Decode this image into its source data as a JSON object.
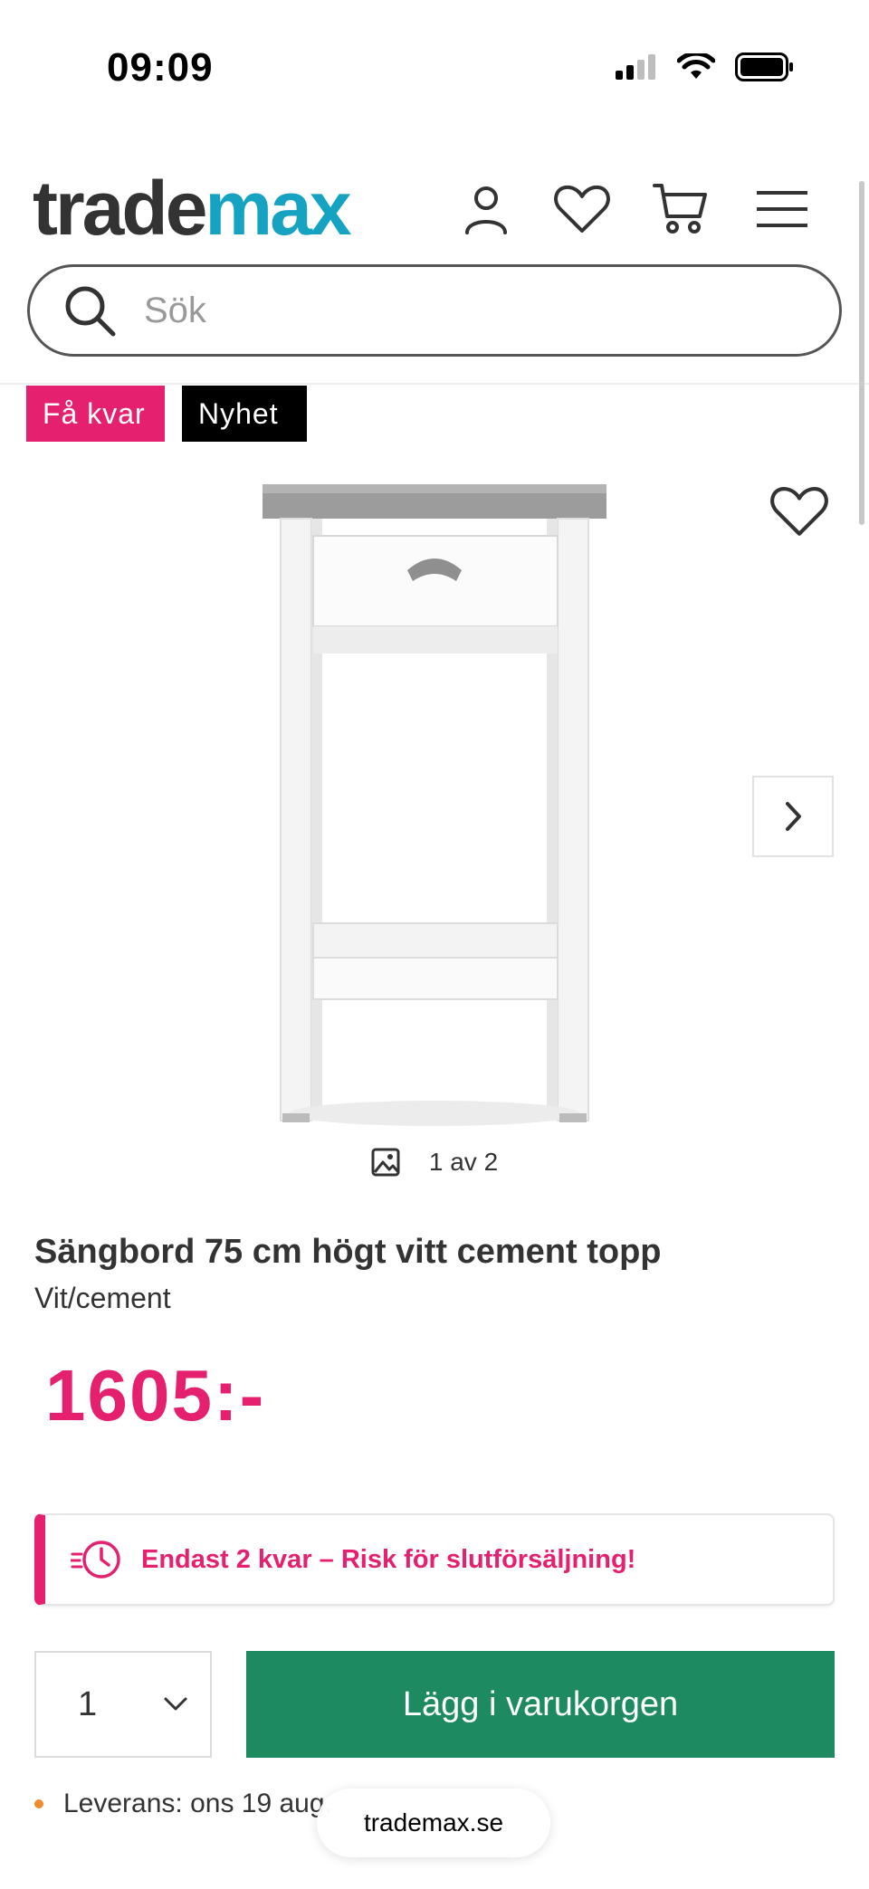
{
  "status_bar": {
    "time": "09:09"
  },
  "header": {
    "logo_trade": "trade",
    "logo_max": "max",
    "icons": [
      "account-icon",
      "wishlist-icon",
      "cart-icon",
      "menu-icon"
    ]
  },
  "search": {
    "placeholder": "Sök"
  },
  "badges": {
    "few_left": "Få kvar",
    "new": "Nyhet"
  },
  "gallery": {
    "counter": "1 av 2"
  },
  "product": {
    "title": "Sängbord 75 cm högt vitt cement topp",
    "variant": "Vit/cement",
    "price": "1605:-"
  },
  "stock_alert": {
    "text": "Endast 2 kvar – Risk för slutförsäljning!"
  },
  "purchase": {
    "quantity": "1",
    "add_to_cart_label": "Lägg i varukorgen"
  },
  "delivery": {
    "text": "Leverans: ons 19 aug."
  },
  "browser": {
    "url": "trademax.se"
  },
  "colors": {
    "brand_pink": "#e5206f",
    "brand_blue": "#16a3c2",
    "cta_green": "#1e8a61",
    "delivery_dot": "#f08c2c"
  }
}
